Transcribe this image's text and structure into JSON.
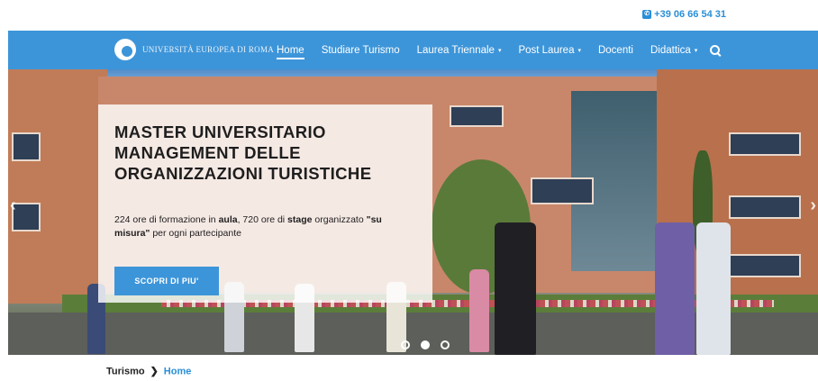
{
  "topbar": {
    "phone": "+39 06 66 54 31",
    "phone_icon": "phone-icon"
  },
  "header": {
    "logo_text": "UNIVERSITÀ EUROPEA DI ROMA",
    "nav": [
      {
        "label": "Home",
        "active": true,
        "dropdown": false
      },
      {
        "label": "Studiare Turismo",
        "active": false,
        "dropdown": false
      },
      {
        "label": "Laurea Triennale",
        "active": false,
        "dropdown": true
      },
      {
        "label": "Post Laurea",
        "active": false,
        "dropdown": true
      },
      {
        "label": "Docenti",
        "active": false,
        "dropdown": false
      },
      {
        "label": "Didattica",
        "active": false,
        "dropdown": true
      }
    ],
    "caret": "▾",
    "search_icon": "search-icon"
  },
  "hero": {
    "title": "MASTER UNIVERSITARIO MANAGEMENT DELLE ORGANIZZAZIONI TURISTICHE",
    "description_parts": [
      {
        "text": "224 ore di formazione in ",
        "bold": false
      },
      {
        "text": "aula",
        "bold": true
      },
      {
        "text": ", 720 ore di ",
        "bold": false
      },
      {
        "text": "stage",
        "bold": true
      },
      {
        "text": " organizzato ",
        "bold": false
      },
      {
        "text": "\"su misura\"",
        "bold": true
      },
      {
        "text": " per ogni partecipante",
        "bold": false
      }
    ],
    "cta_label": "SCOPRI DI PIU'",
    "prev_arrow": "‹",
    "next_arrow": "›",
    "slides_count": 3,
    "active_slide": 1
  },
  "breadcrumb": {
    "root": "Turismo",
    "separator": "❯",
    "current": "Home"
  },
  "colors": {
    "accent": "#3d95d9",
    "link": "#2a8fd6"
  }
}
